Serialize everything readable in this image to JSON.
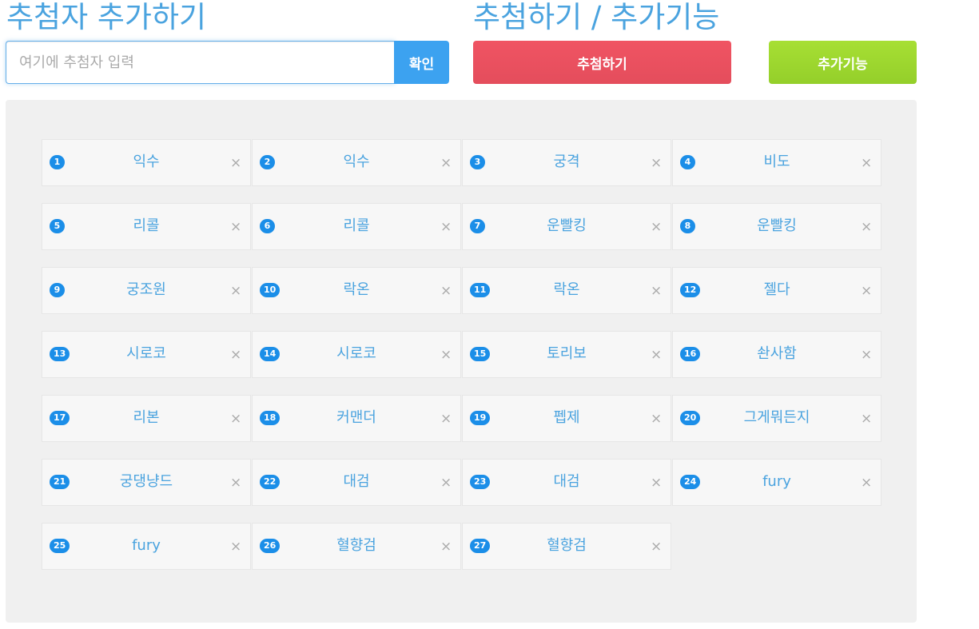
{
  "header": {
    "left_title": "추첨자 추가하기",
    "right_title": "추첨하기 / 추가기능"
  },
  "input": {
    "placeholder": "여기에 추첨자 입력",
    "value": "",
    "confirm_label": "확인"
  },
  "actions": {
    "draw_label": "추첨하기",
    "extra_label": "추가기능"
  },
  "participants": [
    {
      "num": "1",
      "name": "익수"
    },
    {
      "num": "2",
      "name": "익수"
    },
    {
      "num": "3",
      "name": "궁격"
    },
    {
      "num": "4",
      "name": "비도"
    },
    {
      "num": "5",
      "name": "리콜"
    },
    {
      "num": "6",
      "name": "리콜"
    },
    {
      "num": "7",
      "name": "운빨킹"
    },
    {
      "num": "8",
      "name": "운빨킹"
    },
    {
      "num": "9",
      "name": "궁조원"
    },
    {
      "num": "10",
      "name": "락온"
    },
    {
      "num": "11",
      "name": "락온"
    },
    {
      "num": "12",
      "name": "젤다"
    },
    {
      "num": "13",
      "name": "시로코"
    },
    {
      "num": "14",
      "name": "시로코"
    },
    {
      "num": "15",
      "name": "토리보"
    },
    {
      "num": "16",
      "name": "솬사함"
    },
    {
      "num": "17",
      "name": "리본"
    },
    {
      "num": "18",
      "name": "커맨더"
    },
    {
      "num": "19",
      "name": "펩제"
    },
    {
      "num": "20",
      "name": "그게뭐든지"
    },
    {
      "num": "21",
      "name": "궁댕냥드"
    },
    {
      "num": "22",
      "name": "대검"
    },
    {
      "num": "23",
      "name": "대검"
    },
    {
      "num": "24",
      "name": "fury"
    },
    {
      "num": "25",
      "name": "fury"
    },
    {
      "num": "26",
      "name": "혈향검"
    },
    {
      "num": "27",
      "name": "혈향검"
    }
  ],
  "close_glyph": "×",
  "icons": {
    "remove": "close-icon"
  }
}
